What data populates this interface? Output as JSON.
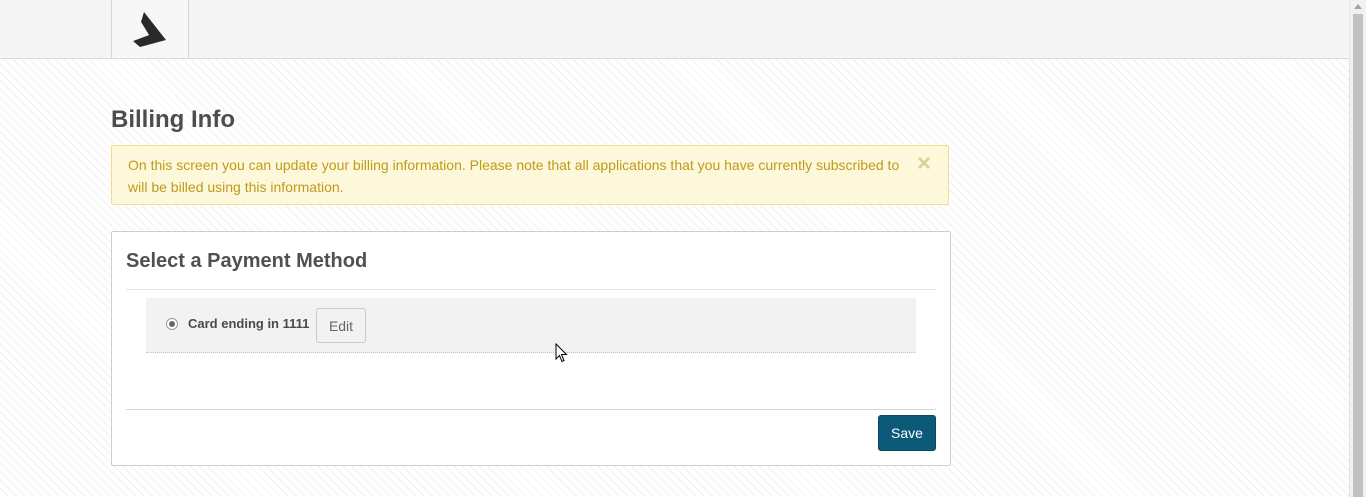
{
  "header": {
    "logo_icon": "triangle-logo-icon"
  },
  "page": {
    "title": "Billing Info"
  },
  "alert": {
    "message": "On this screen you can update your billing information. Please note that all applications that you have currently subscribed to will be billed using this information.",
    "close_label": "×",
    "colors": {
      "background": "#fcf8d9",
      "text": "#c09a1c"
    }
  },
  "payment_panel": {
    "title": "Select a Payment Method",
    "methods": [
      {
        "label": "Card ending in 1111",
        "selected": true,
        "edit_label": "Edit"
      }
    ],
    "save_label": "Save",
    "accent_color": "#0a5a78"
  }
}
